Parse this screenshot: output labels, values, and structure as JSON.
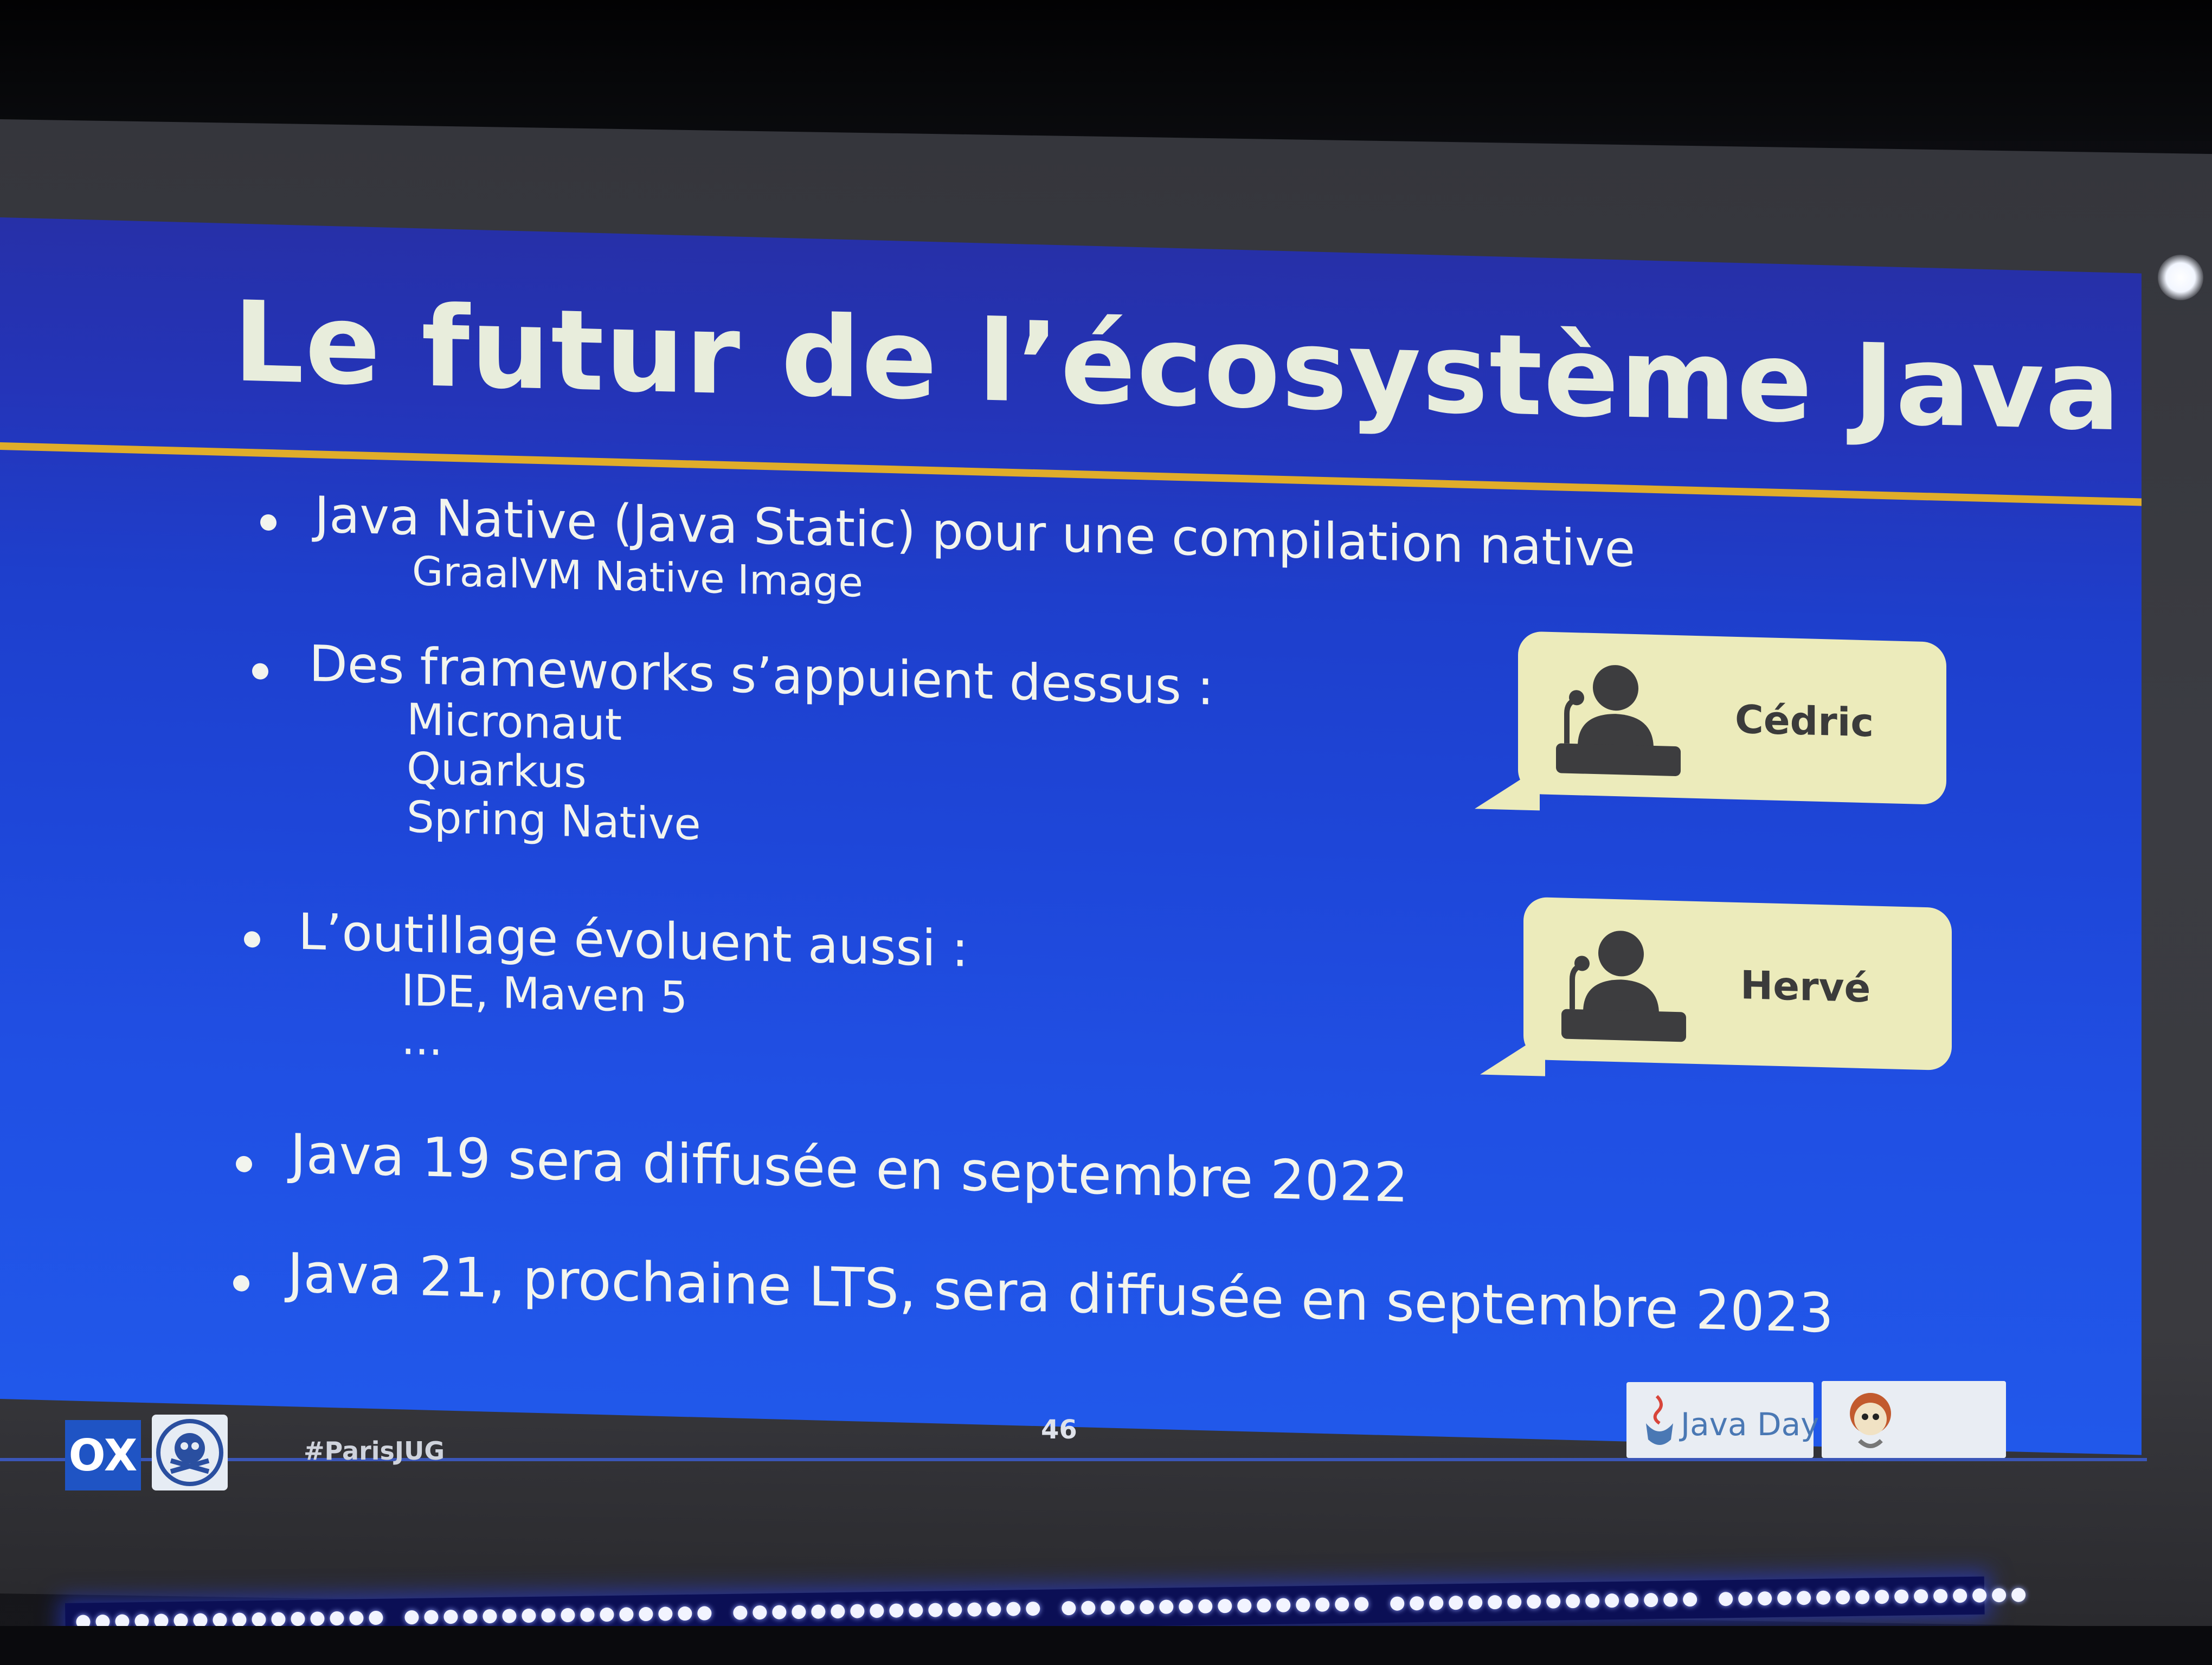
{
  "slide": {
    "title": "Le futur de l’écosystème Java",
    "bullets": [
      {
        "text": "Java Native (Java Static) pour une compilation native",
        "sub": [
          "GraalVM Native Image"
        ]
      },
      {
        "text": "Des frameworks s’appuient dessus :",
        "sub": [
          "Micronaut",
          "Quarkus",
          "Spring Native"
        ]
      },
      {
        "text": "L’outillage évoluent aussi :",
        "sub": [
          "IDE, Maven 5",
          "..."
        ]
      },
      {
        "text": "Java 19 sera diffusée en septembre 2022",
        "sub": []
      },
      {
        "text": "Java 21, prochaine LTS, sera diffusée en septembre 2023",
        "sub": []
      }
    ],
    "speakers": [
      {
        "name": "Cédric",
        "icon": "speaker-at-podium-icon"
      },
      {
        "name": "Hervé",
        "icon": "speaker-at-podium-icon"
      }
    ]
  },
  "footer": {
    "ox_logo": "OX",
    "hashtag": "#ParisJUG",
    "page_number": "46",
    "java_day_logo": "Java Day",
    "paris_jug_logo": "ParisJUG"
  },
  "colors": {
    "slide_top": "#2630a8",
    "slide_bottom": "#2158ea",
    "title_text": "#e8eddc",
    "title_rule": "#e0ad2a",
    "bullet_text": "#f2f4ee",
    "bubble_fill": "#ecebbb",
    "bubble_text": "#3b3b3b"
  }
}
